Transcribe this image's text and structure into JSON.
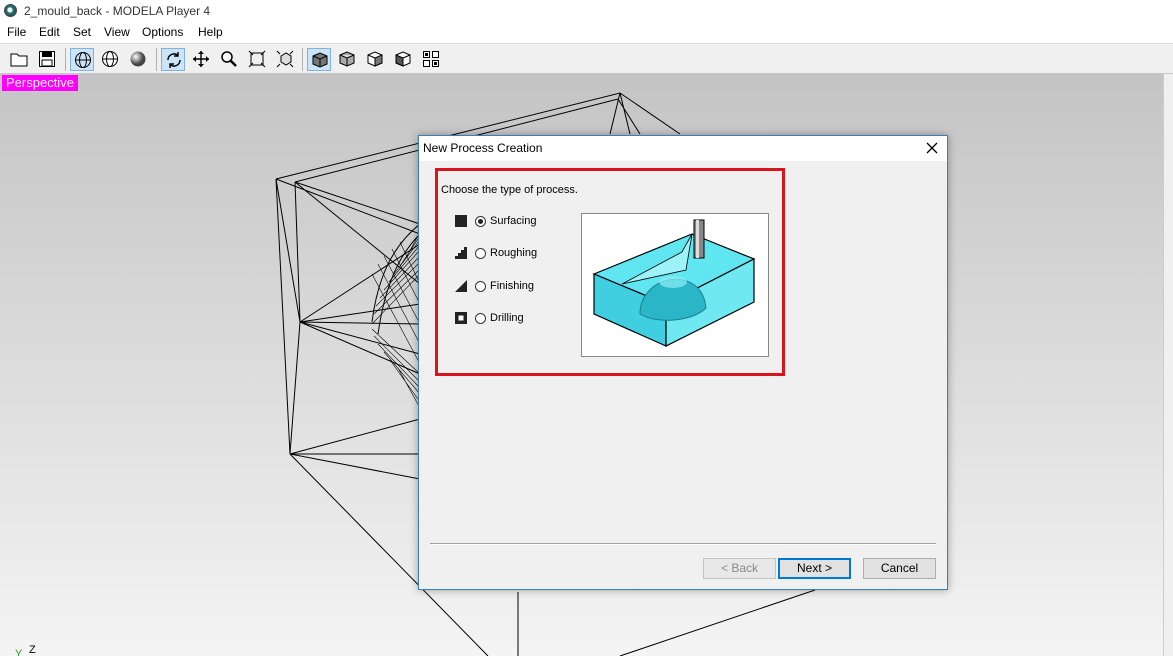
{
  "window": {
    "title": "2_mould_back - MODELA Player 4"
  },
  "menu": [
    "File",
    "Edit",
    "Set",
    "View",
    "Options",
    "Help"
  ],
  "toolbar": {
    "buttons": [
      {
        "icon": "open-folder-icon"
      },
      {
        "icon": "save-icon"
      },
      {
        "icon": "wireframe-view-icon",
        "active": true
      },
      {
        "icon": "hidden-line-view-icon"
      },
      {
        "icon": "shaded-sphere-icon"
      },
      {
        "icon": "rotate-icon",
        "active": true
      },
      {
        "icon": "move-icon"
      },
      {
        "icon": "zoom-icon"
      },
      {
        "icon": "fit-all-icon"
      },
      {
        "icon": "zoom-box-icon"
      },
      {
        "icon": "view-cube-front-icon",
        "active": true
      },
      {
        "icon": "view-cube-top-icon"
      },
      {
        "icon": "view-cube-side-icon"
      },
      {
        "icon": "view-cube-iso-icon"
      },
      {
        "icon": "four-views-icon"
      }
    ]
  },
  "viewport": {
    "label": "Perspective",
    "label_color": "#ff00ff",
    "axis_y": "Y",
    "axis_z": "Z"
  },
  "dialog": {
    "title": "New Process Creation",
    "prompt": "Choose the type of process.",
    "options": [
      {
        "label": "Surfacing",
        "icon": "surfacing-icon",
        "checked": true
      },
      {
        "label": "Roughing",
        "icon": "roughing-icon",
        "checked": false
      },
      {
        "label": "Finishing",
        "icon": "finishing-icon",
        "checked": false
      },
      {
        "label": "Drilling",
        "icon": "drilling-icon",
        "checked": false
      }
    ],
    "buttons": {
      "back": "< Back",
      "next": "Next >",
      "cancel": "Cancel"
    },
    "highlight_color": "#d9141e"
  }
}
